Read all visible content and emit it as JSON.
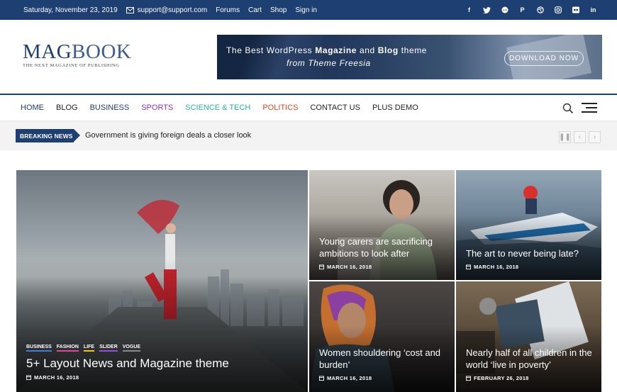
{
  "topbar": {
    "date": "Saturday, November 23, 2019",
    "email": "support@support.com",
    "links": [
      "Forums",
      "Cart",
      "Shop",
      "Sign in"
    ],
    "social_icons": [
      "facebook-icon",
      "twitter-icon",
      "reddit-icon",
      "pinterest-icon",
      "dribbble-icon",
      "instagram-icon",
      "flickr-icon",
      "linkedin-icon"
    ]
  },
  "logo": {
    "name_part1": "MAG",
    "name_part2": "BOOK",
    "tagline": "THE NEXT MAGAZINE OF PUBLISHING"
  },
  "banner": {
    "line1_pre": "The Best WordPress ",
    "line1_b1": "Magazine",
    "line1_mid": " and ",
    "line1_b2": "Blog",
    "line1_post": " theme",
    "line2": "from Theme Freesia",
    "button": "DOWNLOAD NOW"
  },
  "nav": {
    "items": [
      {
        "label": "HOME",
        "color": "#1e3f71"
      },
      {
        "label": "BLOG",
        "color": "#222222"
      },
      {
        "label": "BUSINESS",
        "color": "#1e3f71"
      },
      {
        "label": "SPORTS",
        "color": "#8a36c7"
      },
      {
        "label": "SCIENCE & TECH",
        "color": "#27b39f"
      },
      {
        "label": "POLITICS",
        "color": "#e24a22"
      },
      {
        "label": "CONTACT US",
        "color": "#222222"
      },
      {
        "label": "PLUS DEMO",
        "color": "#222222"
      }
    ]
  },
  "breaking": {
    "label": "BREAKING NEWS",
    "text": "Government is giving foreign deals a closer look"
  },
  "featured": {
    "tags": [
      {
        "label": "BUSINESS",
        "color": "#3f7fd6"
      },
      {
        "label": "FASHION",
        "color": "#e0469a"
      },
      {
        "label": "LIFE",
        "color": "#f2c21d"
      },
      {
        "label": "SLIDER",
        "color": "#9a4be0"
      },
      {
        "label": "VOGUE",
        "color": "#8a8a8a"
      }
    ],
    "title": "5+ Layout News and Magazine theme",
    "date": "MARCH 16, 2018"
  },
  "posts": [
    {
      "title": "Young carers are sacrificing ambitions to look after",
      "date": "MARCH 16, 2018"
    },
    {
      "title": "The art to never being late?",
      "date": "MARCH 16, 2018"
    },
    {
      "title": "Women shouldering ‘cost and burden’",
      "date": "MARCH 16, 2018"
    },
    {
      "title": "Nearly half of all children in the world ‘live in poverty’",
      "date": "FEBRUARY 26, 2018"
    }
  ]
}
